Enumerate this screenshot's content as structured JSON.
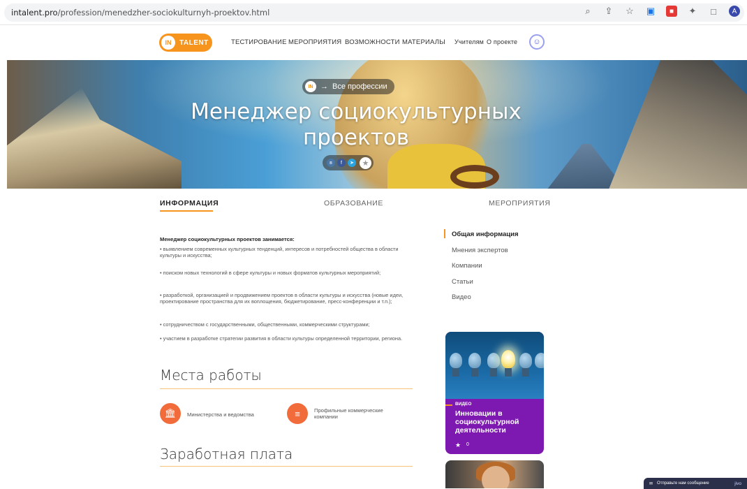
{
  "browser": {
    "url_host": "intalent.pro",
    "url_path": "/profession/menedzher-sociokulturnyh-proektov.html",
    "icons": [
      "zoom-icon",
      "share-icon",
      "bookmark-star-icon",
      "extension-icon",
      "extension-red-icon",
      "puzzle-icon",
      "sidepanel-icon",
      "profile-avatar-icon"
    ],
    "avatar_letter": "A"
  },
  "nav": {
    "logo_in": "IN",
    "logo_text": "TALENT",
    "links": [
      "ТЕСТИРОВАНИЕ",
      "МЕРОПРИЯТИЯ",
      "ВОЗМОЖНОСТИ",
      "МАТЕРИАЛЫ"
    ],
    "teachers": "Учителям",
    "about": "О проекте"
  },
  "hero": {
    "crumb_logo": "IN",
    "crumb_arrow": "→",
    "crumb_text": "Все профессии",
    "title": "Менеджер социокультурных проектов",
    "share": [
      "vk",
      "fb",
      "tg"
    ]
  },
  "tabs": [
    "ИНФОРМАЦИЯ",
    "ОБРАЗОВАНИЕ",
    "МЕРОПРИЯТИЯ"
  ],
  "info": {
    "intro": "Менеджер социокультурных проектов занимается:",
    "bullets": [
      "•   выявлением современных культурных тенденций, интересов и потребностей общества в области культуры и искусства;",
      "•   поиском новых технологий в сфере культуры и новых форматов культурных мероприятий;",
      "•   разработкой, организацией и продвижением проектов в области культуры и искусства (новые идеи, проектирование пространства для их воплощения, бюджетирование, пресс-конференции и т.п.);",
      "•   сотрудничеством с государственными, общественными, коммерческими структурами;",
      "•   участием в разработке стратегии развития в области культуры определенной территории, региона."
    ]
  },
  "workplaces": {
    "title": "Места работы",
    "items": [
      {
        "label": "Министерства и ведомства",
        "icon": "building-icon"
      },
      {
        "label": "Профильные коммерческие компании",
        "icon": "coins-icon"
      }
    ]
  },
  "salary": {
    "title": "Заработная плата"
  },
  "side_menu": [
    "Общая информация",
    "Мнения экспертов",
    "Компании",
    "Статьи",
    "Видео"
  ],
  "card": {
    "tag": "ВИДЕО",
    "title": "Инновации в социокультурной деятельности",
    "likes": "0"
  },
  "chat": {
    "label": "Отправьте нам сообщение",
    "brand": "jivo"
  },
  "colors": {
    "accent": "#f7941d",
    "card_purple": "#7d18b0",
    "icon_orange": "#f26b3a"
  }
}
